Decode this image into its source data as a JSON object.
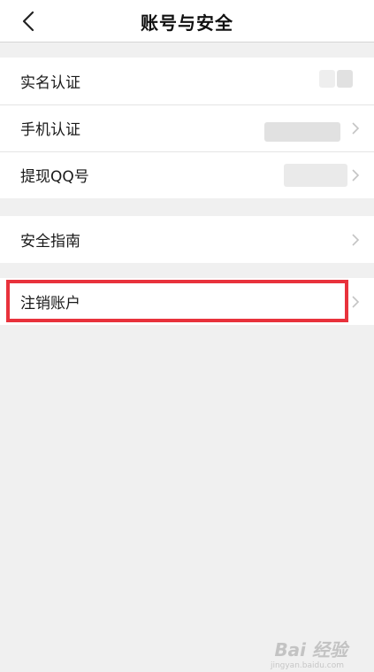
{
  "header": {
    "title": "账号与安全",
    "back_icon": "chevron-left-icon"
  },
  "groups": [
    {
      "items": [
        {
          "label": "实名认证"
        },
        {
          "label": "手机认证"
        },
        {
          "label": "提现QQ号"
        }
      ]
    },
    {
      "items": [
        {
          "label": "安全指南"
        }
      ]
    },
    {
      "items": [
        {
          "label": "注销账户"
        }
      ]
    }
  ],
  "colors": {
    "highlight": "#e8323c",
    "background": "#f0f0f0"
  },
  "watermark": {
    "text": "Bai 经验",
    "subtext": "jingyan.baidu.com"
  }
}
